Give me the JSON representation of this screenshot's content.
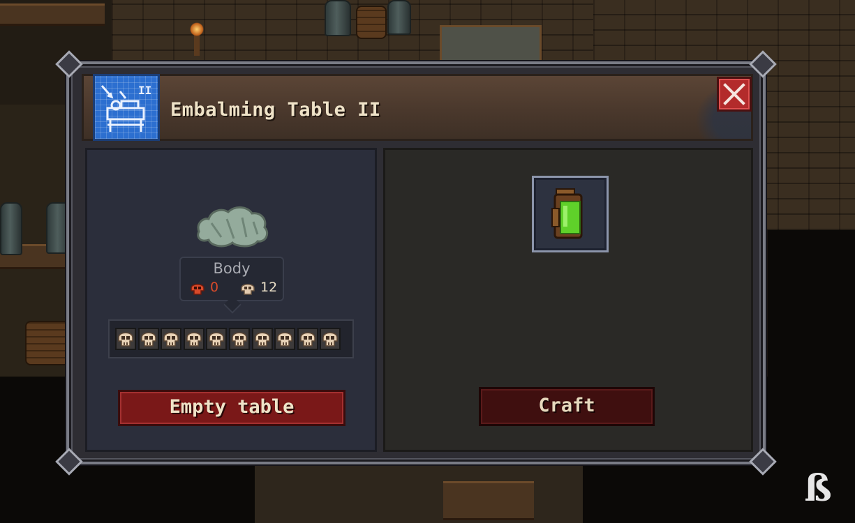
{
  "dialog": {
    "title": "Embalming Table II",
    "close_icon": "close-x-icon",
    "blueprint_icon": "blueprint-embalming-table-icon"
  },
  "left_panel": {
    "body_label": "Body",
    "red_skull_count": "0",
    "bone_skull_count": "12",
    "skull_slots_count": 10,
    "empty_button_label": "Empty table"
  },
  "right_panel": {
    "item_icon": "green-jar-icon",
    "craft_button_label": "Craft"
  },
  "colors": {
    "accent_red": "#b32b2b",
    "red_skull": "#d84a2a",
    "bone": "#eadfc8",
    "header_brown": "#4a382c",
    "panel_blue": "#2b2e3b"
  }
}
